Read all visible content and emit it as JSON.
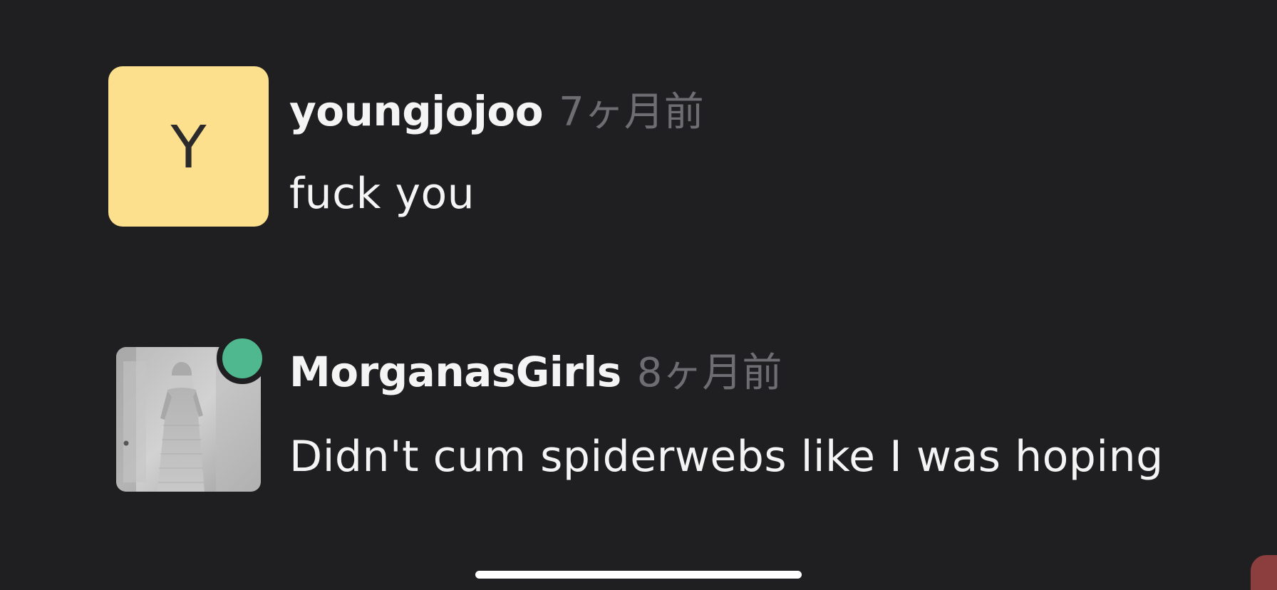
{
  "comments": [
    {
      "username": "youngjojoo",
      "timestamp": "7ヶ月前",
      "text": "fuck you",
      "avatar": {
        "type": "letter",
        "letter": "Y",
        "bg_color": "#fce08e",
        "fg_color": "#2b2b2b"
      }
    },
    {
      "username": "MorganasGirls",
      "timestamp": "8ヶ月前",
      "text": "Didn't cum spiderwebs like I was hoping",
      "avatar": {
        "type": "photo",
        "description_icon": "profile-photo",
        "online": true,
        "online_color": "#4fb88e"
      }
    }
  ],
  "colors": {
    "background": "#1f1f21",
    "text_primary": "#f4f4f4",
    "text_secondary": "#6e6e72",
    "home_indicator": "#ffffff",
    "corner_button": "#8c3d3d"
  },
  "icons": {
    "online_status": "online-status-dot",
    "home_indicator": "home-indicator-bar",
    "corner_button": "corner-button"
  }
}
